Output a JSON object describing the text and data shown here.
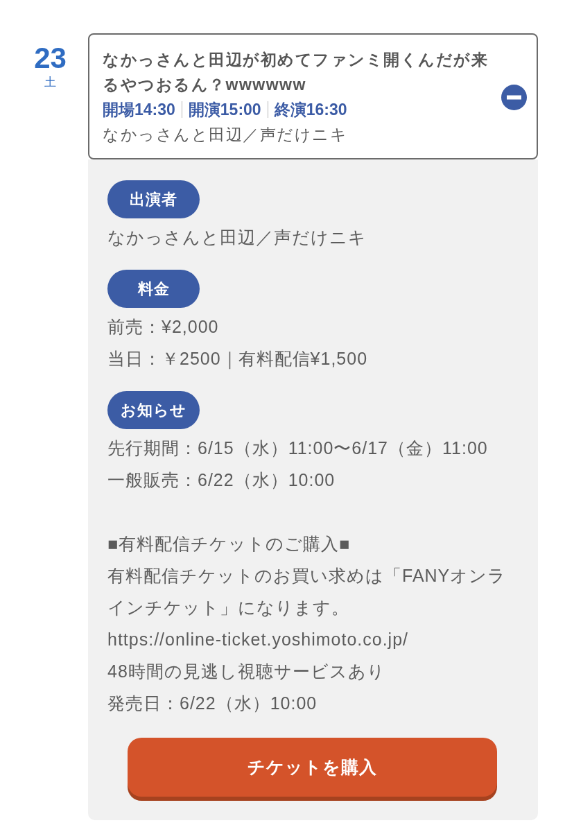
{
  "date": {
    "day": "23",
    "weekday": "土"
  },
  "event": {
    "title": "なかっさんと田辺が初めてファンミ開くんだが来るやつおるん？wwwwww",
    "times": [
      "開場14:30",
      "開演15:00",
      "終演16:30"
    ],
    "performers": "なかっさんと田辺／声だけニキ",
    "expanded": true
  },
  "details": {
    "sections": [
      {
        "label": "出演者",
        "groups": [
          [
            "なかっさんと田辺／声だけニキ"
          ]
        ]
      },
      {
        "label": "料金",
        "groups": [
          [
            "前売：¥2,000",
            "当日：￥2500｜有料配信¥1,500"
          ]
        ]
      },
      {
        "label": "お知らせ",
        "groups": [
          [
            "先行期間：6/15（水）11:00〜6/17（金）11:00",
            "一般販売：6/22（水）10:00"
          ],
          [
            "■有料配信チケットのご購入■",
            "有料配信チケットのお買い求めは「FANYオンラインチケット」になります。",
            "https://online-ticket.yoshimoto.co.jp/",
            "48時間の見逃し視聴サービスあり",
            "発売日：6/22（水）10:00"
          ]
        ]
      }
    ],
    "button": "チケットを購入"
  }
}
